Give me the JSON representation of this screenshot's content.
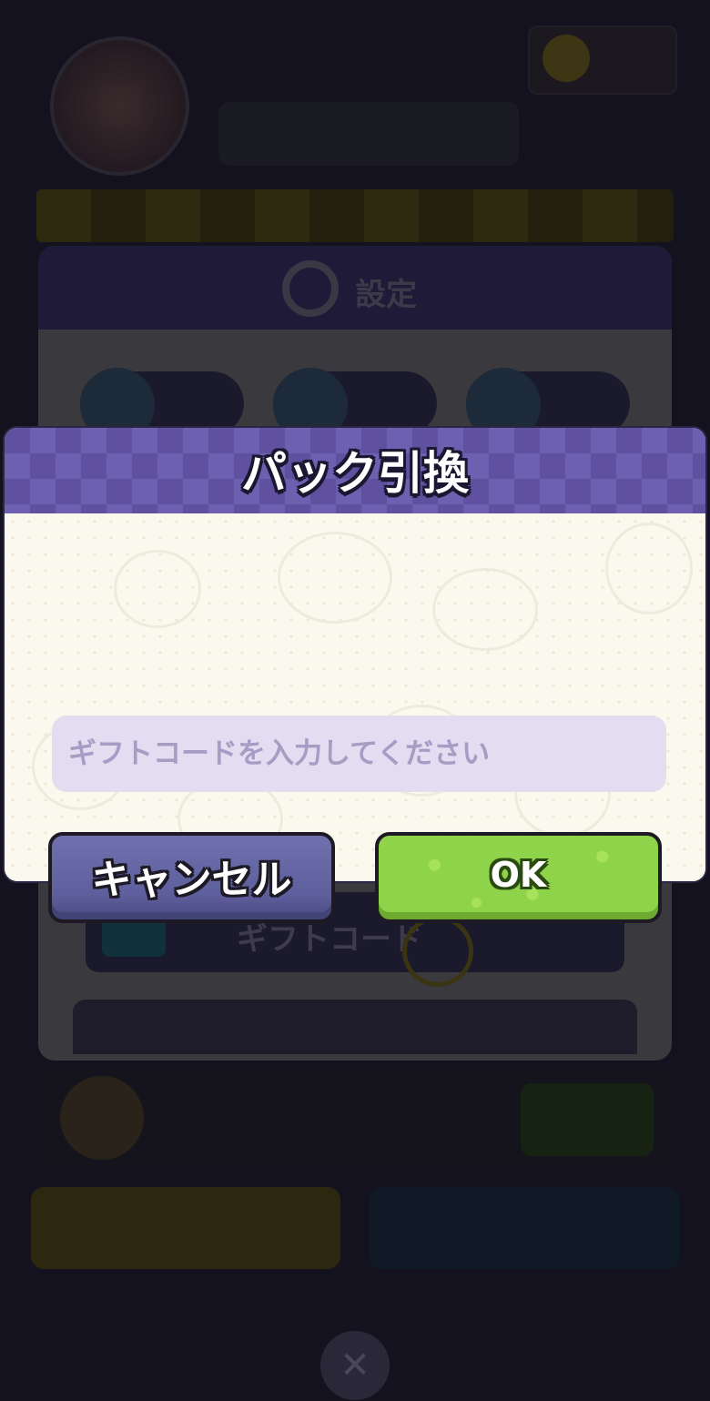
{
  "dialog": {
    "title": "パック引換",
    "input_placeholder": "ギフトコードを入力してください",
    "input_value": "",
    "cancel_label": "キャンセル",
    "ok_label": "OK"
  },
  "background": {
    "settings_title": "設定",
    "gift_code_label": "ギフトコード"
  },
  "colors": {
    "header_purple": "#5f519f",
    "input_bg": "#e3ddf1",
    "cancel_button": "#6f70ae",
    "ok_button": "#8fd34a"
  },
  "icons": {
    "close": "close-icon",
    "settings": "gear-icon"
  }
}
